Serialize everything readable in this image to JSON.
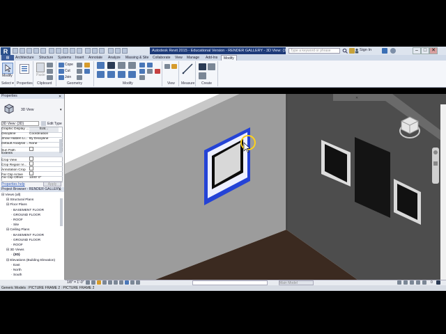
{
  "titlebar": {
    "app_letter": "R",
    "title": "Autodesk Revit 2015 - Educational Version - RENDER GALLERY - 3D View: {3D}",
    "search_placeholder": "Type a keyword or phrase",
    "signin": "Sign In",
    "minimize": "–",
    "maximize": "□",
    "close": "✕"
  },
  "ribbon": {
    "tabs": [
      "Architecture",
      "Structure",
      "Systems",
      "Insert",
      "Annotate",
      "Analyze",
      "Massing & Site",
      "Collaborate",
      "View",
      "Manage",
      "Add-Ins",
      "Modify"
    ],
    "active_tab": "Modify",
    "modify_label": "Modify",
    "panels": [
      "Select ▾",
      "Properties",
      "Clipboard",
      "Geometry",
      "Modify",
      "View",
      "Measure",
      "Create"
    ],
    "clipboard_items": [
      "Cope",
      "Cut",
      "Join"
    ],
    "paste_label": "Paste"
  },
  "properties": {
    "header": "Properties",
    "type_name": "3D View",
    "selector": "3D View: {3D}",
    "edit_type": "Edit Type",
    "rows": [
      {
        "key": "Graphic Display ...",
        "val": "Edit..."
      },
      {
        "key": "Discipline",
        "val": "Coordination"
      },
      {
        "key": "Show Hidden Li...",
        "val": "By Discipline"
      },
      {
        "key": "Default Analysis ...",
        "val": "None"
      },
      {
        "key": "Sun Path",
        "val": ""
      },
      {
        "key": "Extents",
        "val": ""
      },
      {
        "key": "Crop View",
        "val": ""
      },
      {
        "key": "Crop Region Vi...",
        "val": ""
      },
      {
        "key": "Annotation Crop",
        "val": ""
      },
      {
        "key": "Far Clip Active",
        "val": ""
      },
      {
        "key": "Far Clip Offset",
        "val": "1000' 0\""
      }
    ],
    "help_link": "Properties help",
    "apply": "Apply"
  },
  "project_browser": {
    "header": "Project Browser - RENDER GALLERY",
    "tree": [
      {
        "level": 0,
        "text": "Views (all)"
      },
      {
        "level": 1,
        "text": "Structural Plans"
      },
      {
        "level": 1,
        "text": "Floor Plans"
      },
      {
        "level": 2,
        "text": "BASEMENT FLOOR"
      },
      {
        "level": 2,
        "text": "GROUND FLOOR"
      },
      {
        "level": 2,
        "text": "ROOF"
      },
      {
        "level": 2,
        "text": "Site"
      },
      {
        "level": 1,
        "text": "Ceiling Plans"
      },
      {
        "level": 2,
        "text": "BASEMENT FLOOR"
      },
      {
        "level": 2,
        "text": "GROUND FLOOR"
      },
      {
        "level": 2,
        "text": "ROOF"
      },
      {
        "level": 1,
        "text": "3D Views"
      },
      {
        "level": 2,
        "text": "{3D}"
      },
      {
        "level": 1,
        "text": "Elevations (Building Elevation)"
      },
      {
        "level": 2,
        "text": "East"
      },
      {
        "level": 2,
        "text": "North"
      },
      {
        "level": 2,
        "text": "South"
      }
    ]
  },
  "view_control": {
    "scale": "1/8\" = 1'-0\"",
    "model": "Main Model",
    "selection_count": "0"
  },
  "status_text": "Generic Models : PICTURE FRAME 2 : PICTURE FRAME 2",
  "colors": {
    "accent": "#1d3a78",
    "wall_left": "#9a9a9a",
    "wall_right": "#4d4d4d",
    "floor": "#3b2a20",
    "selected_frame": "#1a3cff"
  }
}
